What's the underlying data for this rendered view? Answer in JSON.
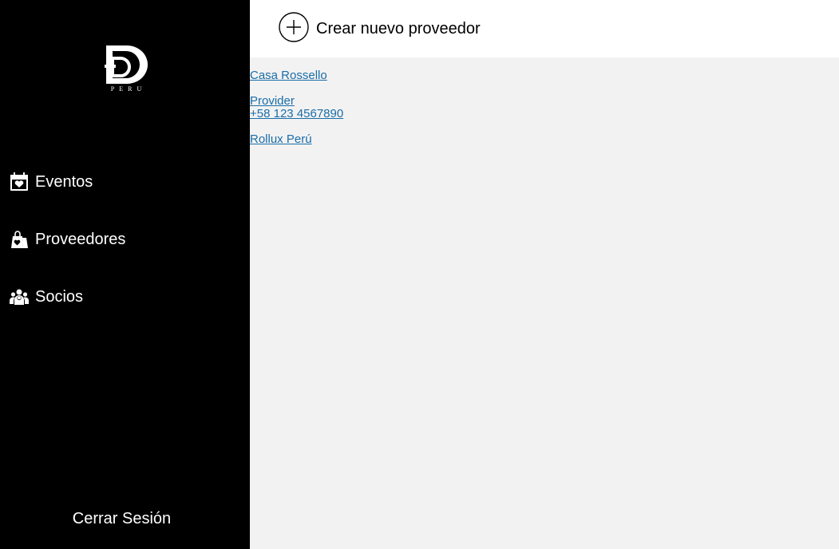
{
  "sidebar": {
    "logo_text": "PERU",
    "items": [
      {
        "label": "Eventos",
        "icon": "calendar-heart-icon"
      },
      {
        "label": "Proveedores",
        "icon": "shopping-bags-heart-icon"
      },
      {
        "label": "Socios",
        "icon": "users-group-icon"
      }
    ],
    "logout_label": "Cerrar Sesión"
  },
  "header": {
    "create_label": "Crear nuevo proveedor",
    "create_icon": "plus-circle-icon"
  },
  "providers": [
    {
      "name": "Casa Rossello",
      "phone": null
    },
    {
      "name": "Provider",
      "phone": "+58 123 4567890"
    },
    {
      "name": "Rollux Perú",
      "phone": null
    }
  ],
  "colors": {
    "sidebar_bg": "#000000",
    "main_bg": "#f2f2f2",
    "topbar_bg": "#ffffff",
    "link": "#1a6ea8"
  }
}
